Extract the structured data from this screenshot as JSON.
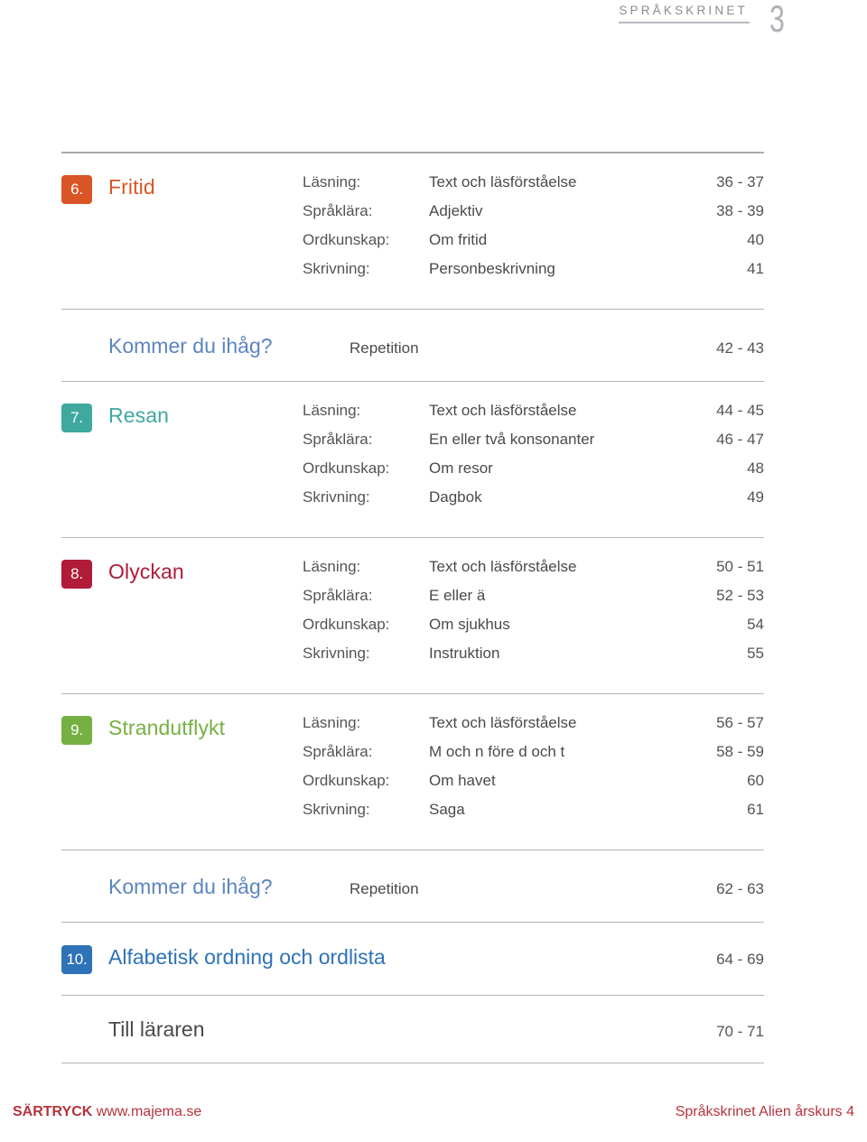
{
  "header": {
    "brand": "SPRÅKSKRINET",
    "page_number": "3",
    "rule_color": "#b9b9c1"
  },
  "colors": {
    "chapter_6": "#da5526",
    "chapter_7": "#3fa9a0",
    "chapter_8": "#b11b38",
    "chapter_9": "#76b043",
    "chapter_10": "#2e72b8",
    "repetition": "#5b85c0",
    "teacher": "#4a4a4a",
    "footer": "#b5333c",
    "rule": "#a9a9a9"
  },
  "toc": {
    "entries": [
      {
        "kind": "chapter",
        "number": "6.",
        "title": "Fritid",
        "color_key": "chapter_6",
        "rows": [
          {
            "label": "Läsning:",
            "value": "Text och läsförståelse",
            "pages": "36 - 37"
          },
          {
            "label": "Språklära:",
            "value": "Adjektiv",
            "pages": "38 - 39"
          },
          {
            "label": "Ordkunskap:",
            "value": "Om fritid",
            "pages": "40"
          },
          {
            "label": "Skrivning:",
            "value": "Personbeskrivning",
            "pages": "41"
          }
        ]
      },
      {
        "kind": "repetition",
        "title": "Kommer du ihåg?",
        "value": "Repetition",
        "pages": "42 - 43"
      },
      {
        "kind": "chapter",
        "number": "7.",
        "title": "Resan",
        "color_key": "chapter_7",
        "rows": [
          {
            "label": "Läsning:",
            "value": "Text och läsförståelse",
            "pages": "44 - 45"
          },
          {
            "label": "Språklära:",
            "value": "En eller två konsonanter",
            "pages": "46 - 47"
          },
          {
            "label": "Ordkunskap:",
            "value": "Om resor",
            "pages": "48"
          },
          {
            "label": "Skrivning:",
            "value": "Dagbok",
            "pages": "49"
          }
        ]
      },
      {
        "kind": "chapter",
        "number": "8.",
        "title": "Olyckan",
        "color_key": "chapter_8",
        "rows": [
          {
            "label": "Läsning:",
            "value": "Text och läsförståelse",
            "pages": "50 - 51"
          },
          {
            "label": "Språklära:",
            "value": "E eller ä",
            "pages": "52 - 53"
          },
          {
            "label": "Ordkunskap:",
            "value": "Om sjukhus",
            "pages": "54"
          },
          {
            "label": "Skrivning:",
            "value": "Instruktion",
            "pages": "55"
          }
        ]
      },
      {
        "kind": "chapter",
        "number": "9.",
        "title": "Strandutflykt",
        "color_key": "chapter_9",
        "rows": [
          {
            "label": "Läsning:",
            "value": "Text och läsförståelse",
            "pages": "56 - 57"
          },
          {
            "label": "Språklära:",
            "value": "M och n före d och t",
            "pages": "58 - 59"
          },
          {
            "label": "Ordkunskap:",
            "value": "Om havet",
            "pages": "60"
          },
          {
            "label": "Skrivning:",
            "value": "Saga",
            "pages": "61"
          }
        ]
      },
      {
        "kind": "repetition",
        "title": "Kommer du ihåg?",
        "value": "Repetition",
        "pages": "62 - 63"
      },
      {
        "kind": "single",
        "number": "10.",
        "title": "Alfabetisk ordning och ordlista",
        "color_key": "chapter_10",
        "pages": "64 - 69"
      },
      {
        "kind": "single",
        "number": "",
        "title": "Till läraren",
        "color_key": "teacher",
        "pages": "70 - 71"
      }
    ]
  },
  "footer": {
    "left_strong": "SÄRTRYCK",
    "left_rest": "www.majema.se",
    "right": "Språkskrinet Alien årskurs 4"
  }
}
